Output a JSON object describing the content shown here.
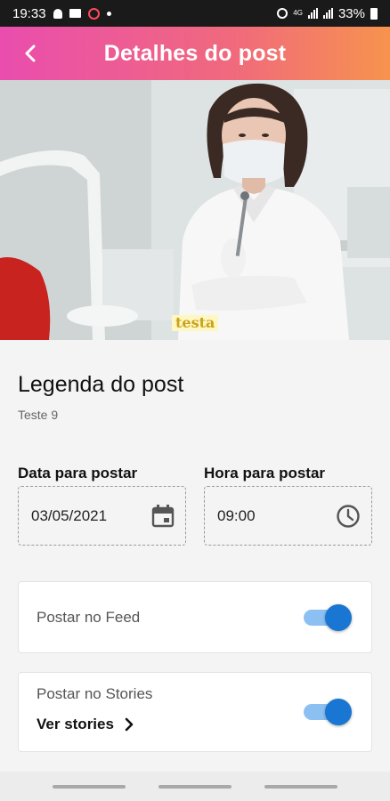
{
  "status_bar": {
    "time": "19:33",
    "battery_text": "33%",
    "network_text": "4G",
    "icons": [
      "bell-icon",
      "mail-icon",
      "app-notification-icon",
      "dot-icon",
      "alarm-icon",
      "signal-icon",
      "battery-icon"
    ]
  },
  "app_bar": {
    "title": "Detalhes do post",
    "back_icon": "chevron-left-icon",
    "gradient": [
      "#ea4dae",
      "#f7934e"
    ]
  },
  "post": {
    "image_caption_overlay": "testa",
    "caption_title": "Legenda do post",
    "caption_text": "Teste 9"
  },
  "schedule": {
    "date_label": "Data para postar",
    "date_value": "03/05/2021",
    "date_icon": "calendar-icon",
    "time_label": "Hora para postar",
    "time_value": "09:00",
    "time_icon": "clock-icon"
  },
  "feed": {
    "label": "Postar no Feed",
    "enabled": true
  },
  "stories": {
    "label": "Postar no Stories",
    "link_label": "Ver stories",
    "link_icon": "chevron-right-icon",
    "enabled": true
  },
  "colors": {
    "toggle_thumb": "#1976d2",
    "toggle_track": "#8cc0f3"
  }
}
